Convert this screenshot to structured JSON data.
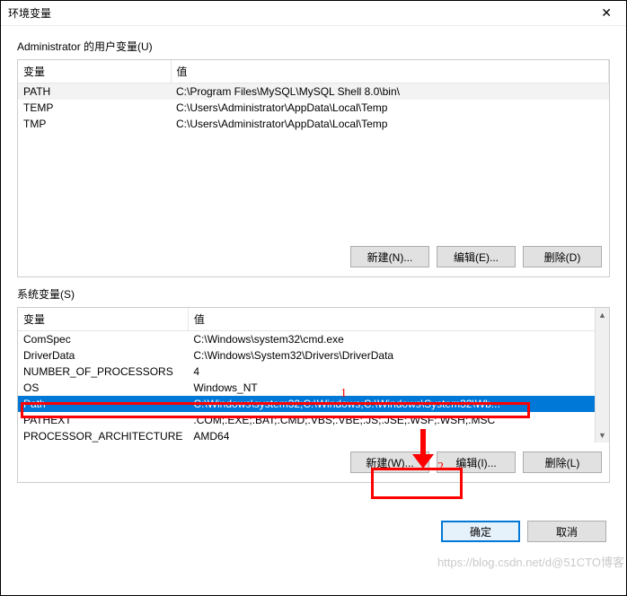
{
  "title": "环境变量",
  "user_section": {
    "label": "Administrator 的用户变量(U)",
    "columns": {
      "variable": "变量",
      "value": "值"
    },
    "rows": [
      {
        "variable": "PATH",
        "value": "C:\\Program Files\\MySQL\\MySQL Shell 8.0\\bin\\"
      },
      {
        "variable": "TEMP",
        "value": "C:\\Users\\Administrator\\AppData\\Local\\Temp"
      },
      {
        "variable": "TMP",
        "value": "C:\\Users\\Administrator\\AppData\\Local\\Temp"
      }
    ],
    "buttons": {
      "new": "新建(N)...",
      "edit": "编辑(E)...",
      "delete": "删除(D)"
    }
  },
  "system_section": {
    "label": "系统变量(S)",
    "columns": {
      "variable": "变量",
      "value": "值"
    },
    "rows": [
      {
        "variable": "ComSpec",
        "value": "C:\\Windows\\system32\\cmd.exe"
      },
      {
        "variable": "DriverData",
        "value": "C:\\Windows\\System32\\Drivers\\DriverData"
      },
      {
        "variable": "NUMBER_OF_PROCESSORS",
        "value": "4"
      },
      {
        "variable": "OS",
        "value": "Windows_NT"
      },
      {
        "variable": "Path",
        "value": "C:\\Windows\\system32;C:\\Windows;C:\\Windows\\System32\\Wb...",
        "selected": true
      },
      {
        "variable": "PATHEXT",
        "value": ".COM;.EXE;.BAT;.CMD;.VBS;.VBE;.JS;.JSE;.WSF;.WSH;.MSC"
      },
      {
        "variable": "PROCESSOR_ARCHITECTURE",
        "value": "AMD64"
      }
    ],
    "buttons": {
      "new": "新建(W)...",
      "edit": "编辑(I)...",
      "delete": "删除(L)"
    }
  },
  "dialog_buttons": {
    "ok": "确定",
    "cancel": "取消"
  },
  "annotations": {
    "one": "1",
    "two": "2"
  },
  "watermark": "https://blog.csdn.net/d@51CTO博客"
}
